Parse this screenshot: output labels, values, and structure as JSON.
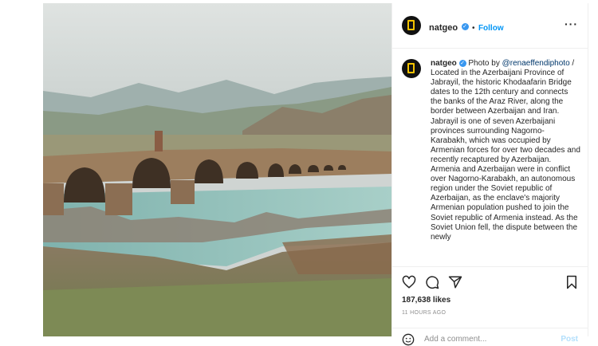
{
  "photo": {
    "alt_icon": "khodaafarin-bridge-photo"
  },
  "header": {
    "username": "natgeo",
    "verified_icon": "verified-badge-icon",
    "separator": "•",
    "follow_label": "Follow",
    "more_icon": "ellipsis-icon"
  },
  "caption": {
    "username": "natgeo",
    "prefix": " Photo by ",
    "mention": "@renaeffendiphoto",
    "text": " / Located in the Azerbaijani Province of Jabrayil, the historic Khodaafarin Bridge dates to the 12th century and connects the banks of the Araz River, along the border between Azerbaijan and Iran. Jabrayil is one of seven Azerbaijani provinces surrounding Nagorno-Karabakh, which was occupied by Armenian forces for over two decades and recently recaptured by Azerbaijan. Armenia and Azerbaijan were in conflict over Nagorno-Karabakh, an autonomous region under the Soviet republic of Azerbaijan, as the enclave's majority Armenian population pushed to join the Soviet republic of Armenia instead. As the Soviet Union fell, the dispute between the newly"
  },
  "actions": {
    "like_icon": "heart-icon",
    "comment_icon": "comment-icon",
    "share_icon": "paper-plane-icon",
    "save_icon": "bookmark-icon",
    "likes": "187,638 likes",
    "time": "11 HOURS AGO"
  },
  "comment_box": {
    "emoji_icon": "emoji-icon",
    "placeholder": "Add a comment...",
    "post_label": "Post"
  },
  "colors": {
    "link_blue": "#0095f6",
    "mention_blue": "#00376b",
    "border": "#efefef"
  }
}
